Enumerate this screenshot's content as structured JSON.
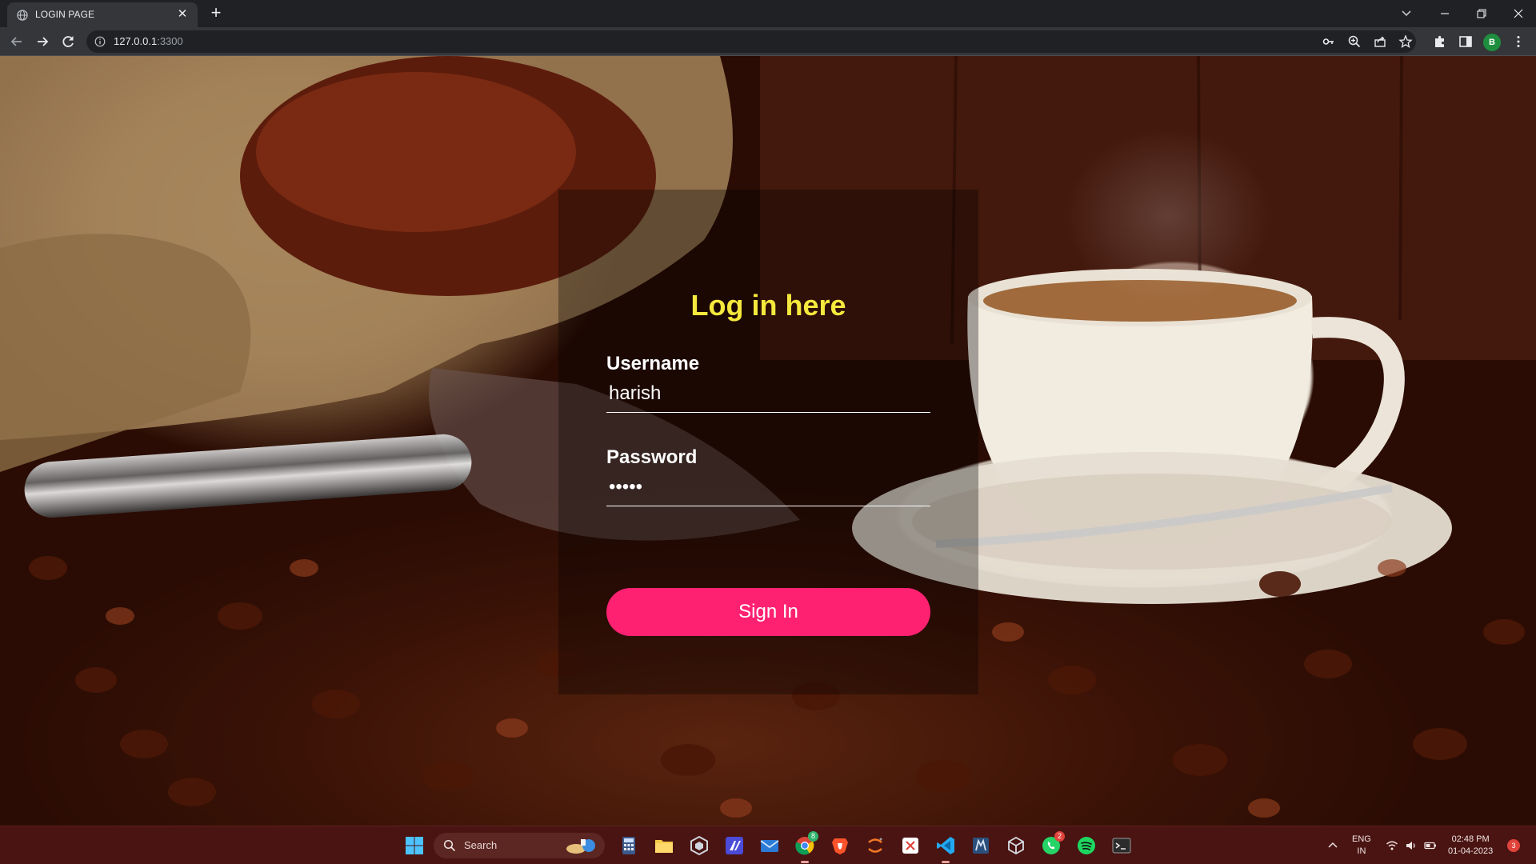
{
  "browser": {
    "tab": {
      "title": "LOGIN PAGE"
    },
    "address": {
      "host": "127.0.0.1",
      "port": ":3300"
    },
    "profile_initial": "B"
  },
  "login": {
    "heading": "Log in here",
    "username_label": "Username",
    "username_value": "harish",
    "password_label": "Password",
    "password_value": "harsh",
    "submit_label": "Sign In",
    "colors": {
      "heading": "#f5e93d",
      "button": "#ff2171"
    }
  },
  "taskbar": {
    "search_placeholder": "Search",
    "chrome_badge": "8",
    "whatsapp_badge": "2",
    "language_line1": "ENG",
    "language_line2": "IN",
    "time": "02:48 PM",
    "date": "01-04-2023",
    "notification_count": "3"
  }
}
